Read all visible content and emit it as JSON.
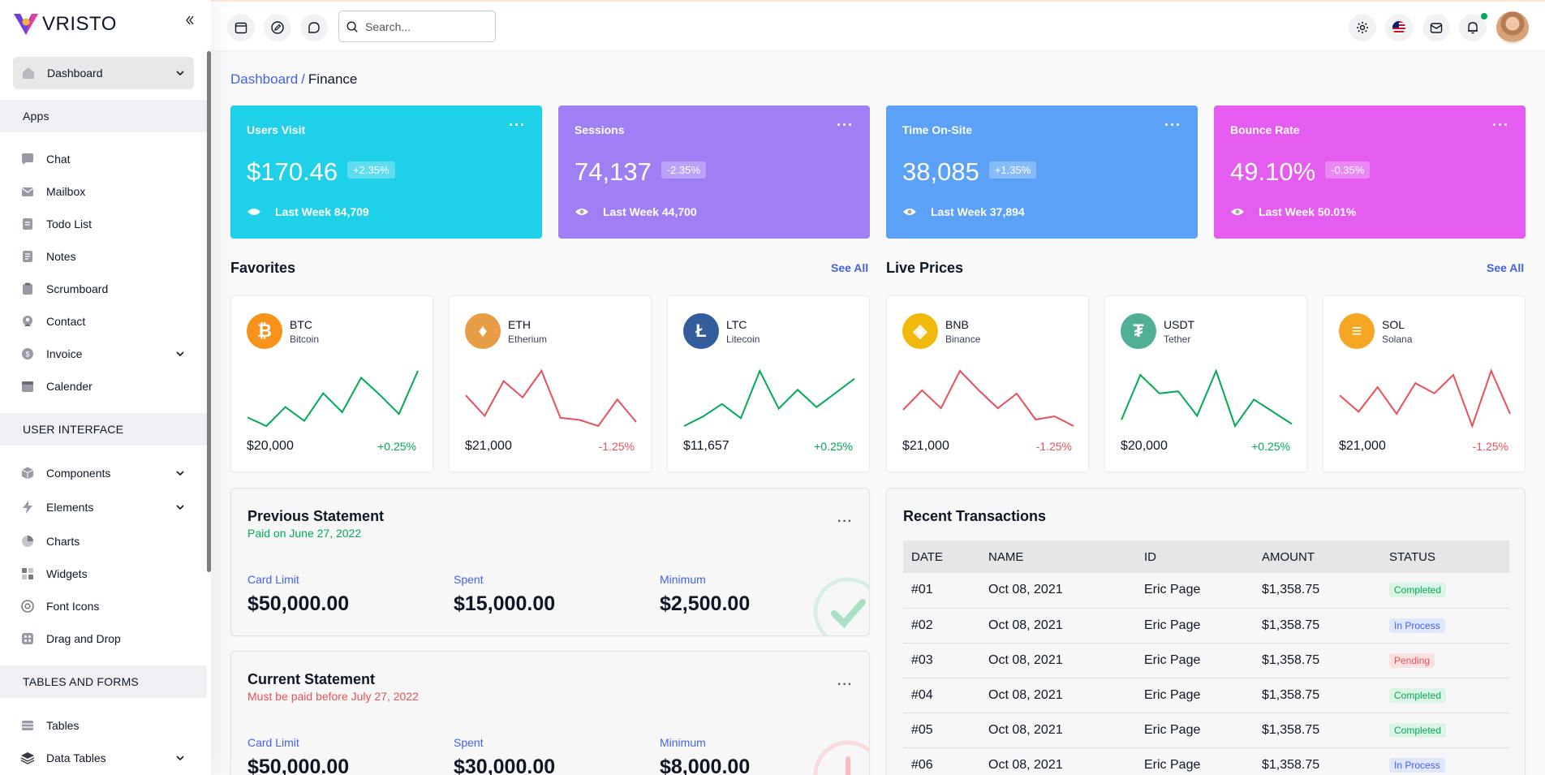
{
  "app": {
    "name": "VRISTO"
  },
  "header": {
    "search_placeholder": "Search..."
  },
  "sidebar": {
    "dashboard_label": "Dashboard",
    "sections": [
      "Apps",
      "USER INTERFACE",
      "TABLES AND FORMS"
    ],
    "apps": [
      "Chat",
      "Mailbox",
      "Todo List",
      "Notes",
      "Scrumboard",
      "Contact",
      "Invoice",
      "Calender"
    ],
    "ui": [
      "Components",
      "Elements",
      "Charts",
      "Widgets",
      "Font Icons",
      "Drag and Drop"
    ],
    "tables": [
      "Tables",
      "Data Tables"
    ]
  },
  "breadcrumb": {
    "parent": "Dashboard",
    "sep": "/",
    "current": "Finance"
  },
  "stats": [
    {
      "title": "Users Visit",
      "value": "$170.46",
      "badge": "+2.35%",
      "week": "Last Week 84,709",
      "color": "#1fd0e9"
    },
    {
      "title": "Sessions",
      "value": "74,137",
      "badge": "-2.35%",
      "week": "Last Week 44,700",
      "color": "#a07ff5"
    },
    {
      "title": "Time On-Site",
      "value": "38,085",
      "badge": "+1.35%",
      "week": "Last Week 37,894",
      "color": "#5aa1f7"
    },
    {
      "title": "Bounce Rate",
      "value": "49.10%",
      "badge": "-0.35%",
      "week": "Last Week 50.01%",
      "color": "#e45cf0"
    }
  ],
  "favorites": {
    "title": "Favorites",
    "see_all": "See All"
  },
  "live_prices": {
    "title": "Live Prices",
    "see_all": "See All"
  },
  "coins": [
    {
      "symbol": "BTC",
      "name": "Bitcoin",
      "price": "$20,000",
      "change": "+0.25%",
      "trend": "up",
      "logo_color": "#f7931a",
      "logo_glyph": "₿",
      "points": [
        12,
        7,
        18,
        10,
        26,
        15,
        35,
        25,
        14,
        39
      ]
    },
    {
      "symbol": "ETH",
      "name": "Etherium",
      "price": "$21,000",
      "change": "-1.25%",
      "trend": "down",
      "logo_color": "#e69d45",
      "logo_glyph": "♦",
      "points": [
        26,
        16,
        33,
        25,
        38,
        15,
        14,
        11,
        24,
        13
      ]
    },
    {
      "symbol": "LTC",
      "name": "Litecoin",
      "price": "$11,657",
      "change": "+0.25%",
      "trend": "up",
      "logo_color": "#345d9d",
      "logo_glyph": "Ł",
      "points": [
        5,
        11,
        19,
        10,
        40,
        16,
        28,
        17,
        26,
        35
      ]
    },
    {
      "symbol": "BNB",
      "name": "Binance",
      "price": "$21,000",
      "change": "-1.25%",
      "trend": "down",
      "logo_color": "#f0b90b",
      "logo_glyph": "◈",
      "points": [
        20,
        32,
        21,
        44,
        32,
        21,
        30,
        14,
        16,
        10
      ]
    },
    {
      "symbol": "USDT",
      "name": "Tether",
      "price": "$20,000",
      "change": "+0.25%",
      "trend": "up",
      "logo_color": "#50af95",
      "logo_glyph": "₮",
      "points": [
        16,
        38,
        29,
        30,
        18,
        40,
        13,
        26,
        20,
        14
      ]
    },
    {
      "symbol": "SOL",
      "name": "Solana",
      "price": "$21,000",
      "change": "-1.25%",
      "trend": "down",
      "logo_color": "#f5a623",
      "logo_glyph": "≡",
      "points": [
        26,
        18,
        30,
        17,
        32,
        27,
        36,
        11,
        38,
        17
      ]
    }
  ],
  "statements": [
    {
      "title": "Previous Statement",
      "sub": "Paid on June 27, 2022",
      "sub_color": "#00ab55",
      "card_limit_label": "Card Limit",
      "card_limit": "$50,000.00",
      "spent_label": "Spent",
      "spent": "$15,000.00",
      "minimum_label": "Minimum",
      "minimum": "$2,500.00",
      "deco_color": "#a8e0c4"
    },
    {
      "title": "Current Statement",
      "sub": "Must be paid before July 27, 2022",
      "sub_color": "#e7515a",
      "card_limit_label": "Card Limit",
      "card_limit": "$50,000.00",
      "spent_label": "Spent",
      "spent": "$30,000.00",
      "minimum_label": "Minimum",
      "minimum": "$8,000.00",
      "deco_color": "#f6bcc0"
    }
  ],
  "transactions": {
    "title": "Recent Transactions",
    "columns": [
      "DATE",
      "NAME",
      "ID",
      "AMOUNT",
      "STATUS"
    ],
    "rows": [
      {
        "id": "#01",
        "date": "Oct 08, 2021",
        "name": "Eric Page",
        "amount": "$1,358.75",
        "status": "Completed"
      },
      {
        "id": "#02",
        "date": "Oct 08, 2021",
        "name": "Eric Page",
        "amount": "$1,358.75",
        "status": "In Process"
      },
      {
        "id": "#03",
        "date": "Oct 08, 2021",
        "name": "Eric Page",
        "amount": "$1,358.75",
        "status": "Pending"
      },
      {
        "id": "#04",
        "date": "Oct 08, 2021",
        "name": "Eric Page",
        "amount": "$1,358.75",
        "status": "Completed"
      },
      {
        "id": "#05",
        "date": "Oct 08, 2021",
        "name": "Eric Page",
        "amount": "$1,358.75",
        "status": "Completed"
      },
      {
        "id": "#06",
        "date": "Oct 08, 2021",
        "name": "Eric Page",
        "amount": "$1,358.75",
        "status": "In Process"
      }
    ]
  },
  "colors": {
    "accent": "#4361ee",
    "success": "#00ab55",
    "danger": "#e7515a"
  }
}
